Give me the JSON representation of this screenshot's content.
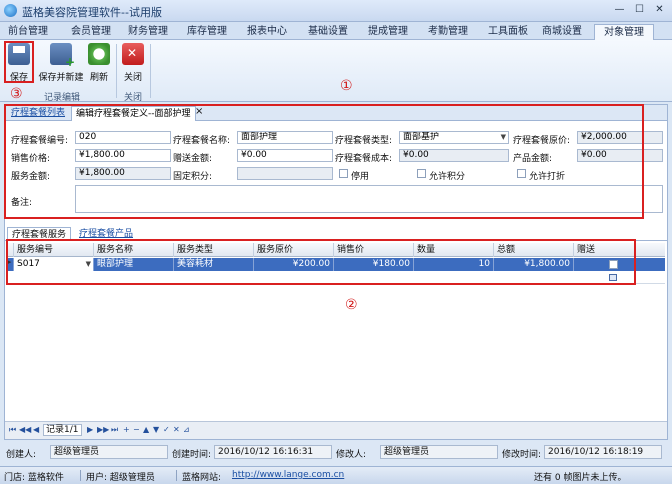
{
  "window": {
    "title": "蓝格美容院管理软件--试用版",
    "min": "—",
    "max": "☐",
    "close": "✕"
  },
  "menu_tabs": [
    "前台管理",
    "会员管理",
    "财务管理",
    "库存管理",
    "报表中心",
    "基础设置",
    "提成管理",
    "考勤管理",
    "工具面板",
    "商城设置",
    "对象管理"
  ],
  "ribbon": {
    "save": "保存",
    "save_new": "保存并新建",
    "refresh": "刷新",
    "close": "关闭",
    "group_record": "记录编辑",
    "group_close": "关闭"
  },
  "annotations": {
    "one": "①",
    "two": "②",
    "three": "③"
  },
  "page_tabs": {
    "list": "疗程套餐列表",
    "edit": "编辑疗程套餐定义--面部护理",
    "close": "×"
  },
  "form": {
    "code_label": "疗程套餐编号:",
    "code": "020",
    "name_label": "疗程套餐名称:",
    "name": "面部护理",
    "type_label": "疗程套餐类型:",
    "type": "面部基护",
    "orig_price_label": "疗程套餐原价:",
    "orig_price": "¥2,000.00",
    "sale_price_label": "销售价格:",
    "sale_price": "¥1,800.00",
    "gift_amount_label": "赠送金额:",
    "gift_amount": "¥0.00",
    "cost_label": "疗程套餐成本:",
    "cost": "¥0.00",
    "product_amount_label": "产品金额:",
    "product_amount": "¥0.00",
    "service_amount_label": "服务金额:",
    "service_amount": "¥1,800.00",
    "fixed_points_label": "固定积分:",
    "fixed_points": "",
    "disabled_label": "停用",
    "allow_points_label": "允许积分",
    "allow_discount_label": "允许打折",
    "remark_label": "备注:",
    "remark": ""
  },
  "detail_tabs": {
    "service": "疗程套餐服务",
    "product": "疗程套餐产品"
  },
  "grid": {
    "columns": [
      "服务编号",
      "服务名称",
      "服务类型",
      "服务原价",
      "销售价",
      "数量",
      "总额",
      "赠送"
    ],
    "rows": [
      {
        "code": "S017",
        "name": "眼部护理",
        "type": "美容耗材",
        "orig_price": "¥200.00",
        "sale_price": "¥180.00",
        "qty": "10",
        "total": "¥1,800.00",
        "gift": ""
      }
    ]
  },
  "navigator": {
    "first": "⏮",
    "prev_page": "◀◀",
    "prev": "◀",
    "record": "记录1/1",
    "next": "▶",
    "next_page": "▶▶",
    "last": "⏭",
    "add": "+",
    "remove": "−",
    "up": "▲",
    "down": "▼",
    "apply": "✓",
    "cancel": "✕",
    "filter": "⊿"
  },
  "info": {
    "creator_label": "创建人:",
    "creator": "超级管理员",
    "created_label": "创建时间:",
    "created": "2016/10/12 16:16:31",
    "modifier_label": "修改人:",
    "modifier": "超级管理员",
    "modified_label": "修改时间:",
    "modified": "2016/10/12 16:18:19"
  },
  "status": {
    "store": "门店: 蓝格软件",
    "user": "用户: 超级管理员",
    "site_label": "蓝格网站:",
    "site": "http://www.lange.com.cn",
    "right": "还有 0 帧图片未上传。"
  },
  "colors": {
    "accent": "#3c6cbf",
    "annotation": "#d21a1a"
  }
}
